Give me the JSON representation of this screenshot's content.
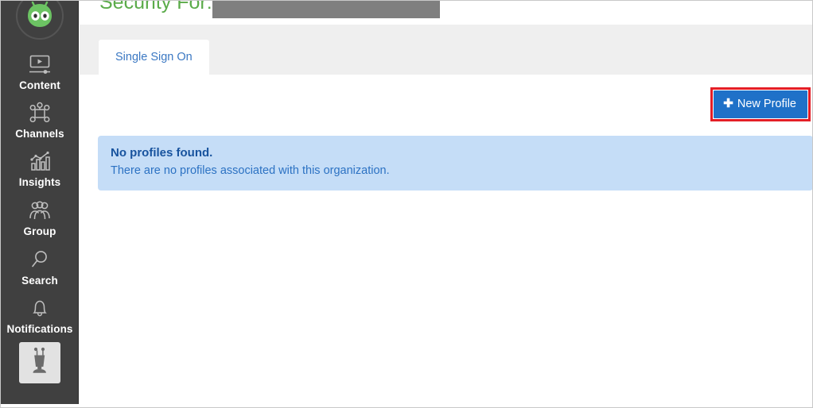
{
  "sidebar": {
    "brand_icon": "green-robot-avatar-icon",
    "items": [
      {
        "label": "Content",
        "icon": "video-monitor-icon"
      },
      {
        "label": "Channels",
        "icon": "network-nodes-icon"
      },
      {
        "label": "Insights",
        "icon": "bar-chart-trend-icon"
      },
      {
        "label": "Group",
        "icon": "people-group-icon"
      },
      {
        "label": "Search",
        "icon": "magnifier-icon"
      },
      {
        "label": "Notifications",
        "icon": "bell-icon"
      }
    ],
    "user_tile_icon": "robot-user-avatar-icon",
    "background_color": "#404040"
  },
  "header": {
    "title": "Security For:",
    "title_color": "#5bab4a",
    "redacted_value": "",
    "redaction_color": "#7f7f7f"
  },
  "tabs": [
    {
      "label": "Single Sign On",
      "selected": true
    }
  ],
  "toolbar": {
    "new_profile_label": "New Profile",
    "new_profile_icon": "plus-icon",
    "new_profile_color": "#1f71c8",
    "highlight_color": "#e41e26"
  },
  "alert": {
    "title": "No profiles found.",
    "message": "There are no profiles associated with this organization.",
    "background_color": "#c5ddf7",
    "title_color": "#18539e",
    "text_color": "#2c72c3"
  }
}
